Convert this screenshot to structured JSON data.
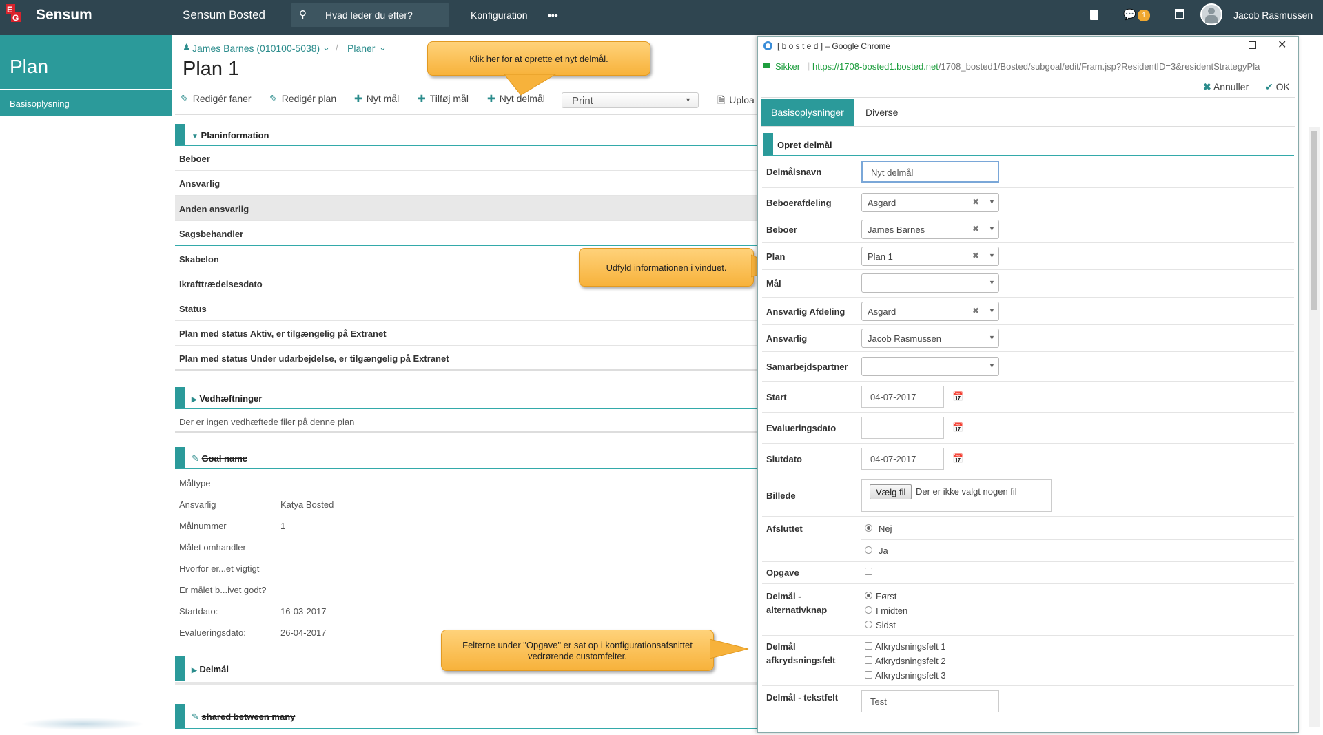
{
  "topbar": {
    "brand": "Sensum",
    "app_name": "Sensum Bosted",
    "search_placeholder": "Hvad leder du efter?",
    "konfiguration": "Konfiguration",
    "more": "•••",
    "badge_count": "1",
    "user": "Jacob Rasmussen"
  },
  "left": {
    "title": "Plan",
    "item": "Basisoplysning"
  },
  "breadcrumb": {
    "resident": "James Barnes (010100-5038)",
    "planer": "Planer"
  },
  "page_title": "Plan 1",
  "toolbar": {
    "rediger_faner": "Redigér faner",
    "rediger_plan": "Redigér plan",
    "nyt_maal": "Nyt mål",
    "tilfoej_maal": "Tilføj mål",
    "nyt_delmaal": "Nyt delmål",
    "print": "Print",
    "upload": "Uploa"
  },
  "planinfo": {
    "title": "Planinformation",
    "rows": [
      "Beboer",
      "Ansvarlig",
      "Anden ansvarlig",
      "Sagsbehandler",
      "Skabelon",
      "Ikrafttrædelsesdato",
      "Status",
      "Plan med status Aktiv, er tilgængelig på Extranet",
      "Plan med status Under udarbejdelse, er tilgængelig på Extranet"
    ]
  },
  "vedhaeft": {
    "title": "Vedhæftninger",
    "empty": "Der er ingen vedhæftede filer på denne plan"
  },
  "goal": {
    "title": "Goal name",
    "rows": [
      {
        "label": "Måltype",
        "value": ""
      },
      {
        "label": "Ansvarlig",
        "value": "Katya Bosted"
      },
      {
        "label": "Målnummer",
        "value": "1"
      },
      {
        "label": "Målet omhandler",
        "value": ""
      },
      {
        "label": "Hvorfor er...et vigtigt",
        "value": ""
      },
      {
        "label": "Er målet b...ivet godt?",
        "value": ""
      },
      {
        "label": "Startdato:",
        "value": "16-03-2017"
      },
      {
        "label": "Evalueringsdato:",
        "value": "26-04-2017"
      }
    ]
  },
  "delmaal_section": "Delmål",
  "shared_section": "shared between many",
  "callouts": {
    "c1": "Klik her for at oprette et nyt delmål.",
    "c2": "Udfyld informationen i vinduet.",
    "c3": "Felterne under \"Opgave\" er sat op i konfigurationsafsnittet vedrørende customfelter."
  },
  "chrome": {
    "title": "[ b o s t e d ] – Google Chrome",
    "secure": "Sikker",
    "url_host": "https://1708-bosted1.bosted.net",
    "url_path": "/1708_bosted1/Bosted/subgoal/edit/Fram.jsp?ResidentID=3&residentStrategyPla",
    "annuller": "Annuller",
    "ok": "OK",
    "tab_active": "Basisoplysninger",
    "tab_other": "Diverse",
    "form_title": "Opret delmål"
  },
  "form": {
    "delmaalsnavn": {
      "label": "Delmålsnavn",
      "value": "Nyt delmål"
    },
    "beboerafdeling": {
      "label": "Beboerafdeling",
      "value": "Asgard"
    },
    "beboer": {
      "label": "Beboer",
      "value": "James Barnes"
    },
    "plan": {
      "label": "Plan",
      "value": "Plan 1"
    },
    "maal": {
      "label": "Mål",
      "value": ""
    },
    "ansvarlig_afd": {
      "label": "Ansvarlig Afdeling",
      "value": "Asgard"
    },
    "ansvarlig": {
      "label": "Ansvarlig",
      "value": "Jacob Rasmussen"
    },
    "samarbejd": {
      "label": "Samarbejdspartner",
      "value": ""
    },
    "start": {
      "label": "Start",
      "value": "04-07-2017"
    },
    "evaluering": {
      "label": "Evalueringsdato",
      "value": ""
    },
    "slutdato": {
      "label": "Slutdato",
      "value": "04-07-2017"
    },
    "billede": {
      "label": "Billede",
      "button": "Vælg fil",
      "none": "Der er ikke valgt nogen fil"
    },
    "afsluttet": {
      "label": "Afsluttet",
      "nej": "Nej",
      "ja": "Ja"
    },
    "opgave": {
      "label": "Opgave"
    },
    "alt": {
      "label1": "Delmål -",
      "label2": "alternativknap",
      "opts": [
        "Først",
        "I midten",
        "Sidst"
      ]
    },
    "afkryds": {
      "label1": "Delmål",
      "label2": "afkrydsningsfelt",
      "opts": [
        "Afkrydsningsfelt 1",
        "Afkrydsningsfelt 2",
        "Afkrydsningsfelt 3"
      ]
    },
    "tekst": {
      "label": "Delmål - tekstfelt",
      "value": "Test"
    }
  }
}
